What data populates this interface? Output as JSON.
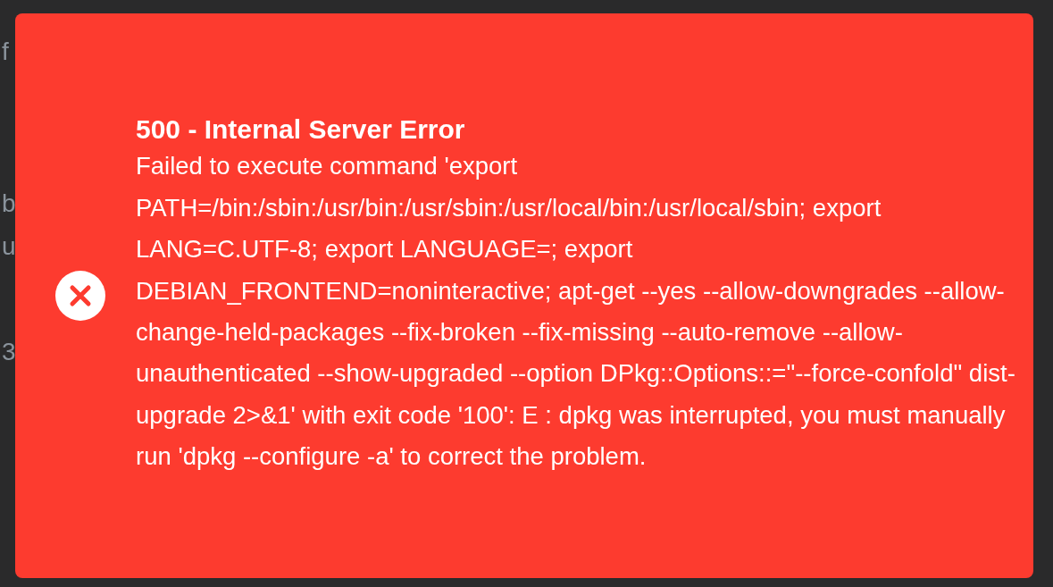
{
  "background_fragments": [
    "f",
    "b",
    "u",
    "3"
  ],
  "toast": {
    "kind": "error",
    "title": "500 - Internal Server Error",
    "message": "Failed to execute command 'export PATH=/bin:/sbin:/usr/bin:/usr/sbin:/usr/local/bin:/usr/local/sbin; export LANG=C.UTF-8; export LANGUAGE=; export DEBIAN_FRONTEND=noninteractive; apt-get --yes --allow-downgrades --allow-change-held-packages --fix-broken --fix-missing --auto-remove --allow-unauthenticated --show-upgraded --option DPkg::Options::=\"--force-confold\" dist-upgrade 2>&1' with exit code '100': E : dpkg was interrupted, you must manually run 'dpkg --configure -a' to correct the problem."
  }
}
